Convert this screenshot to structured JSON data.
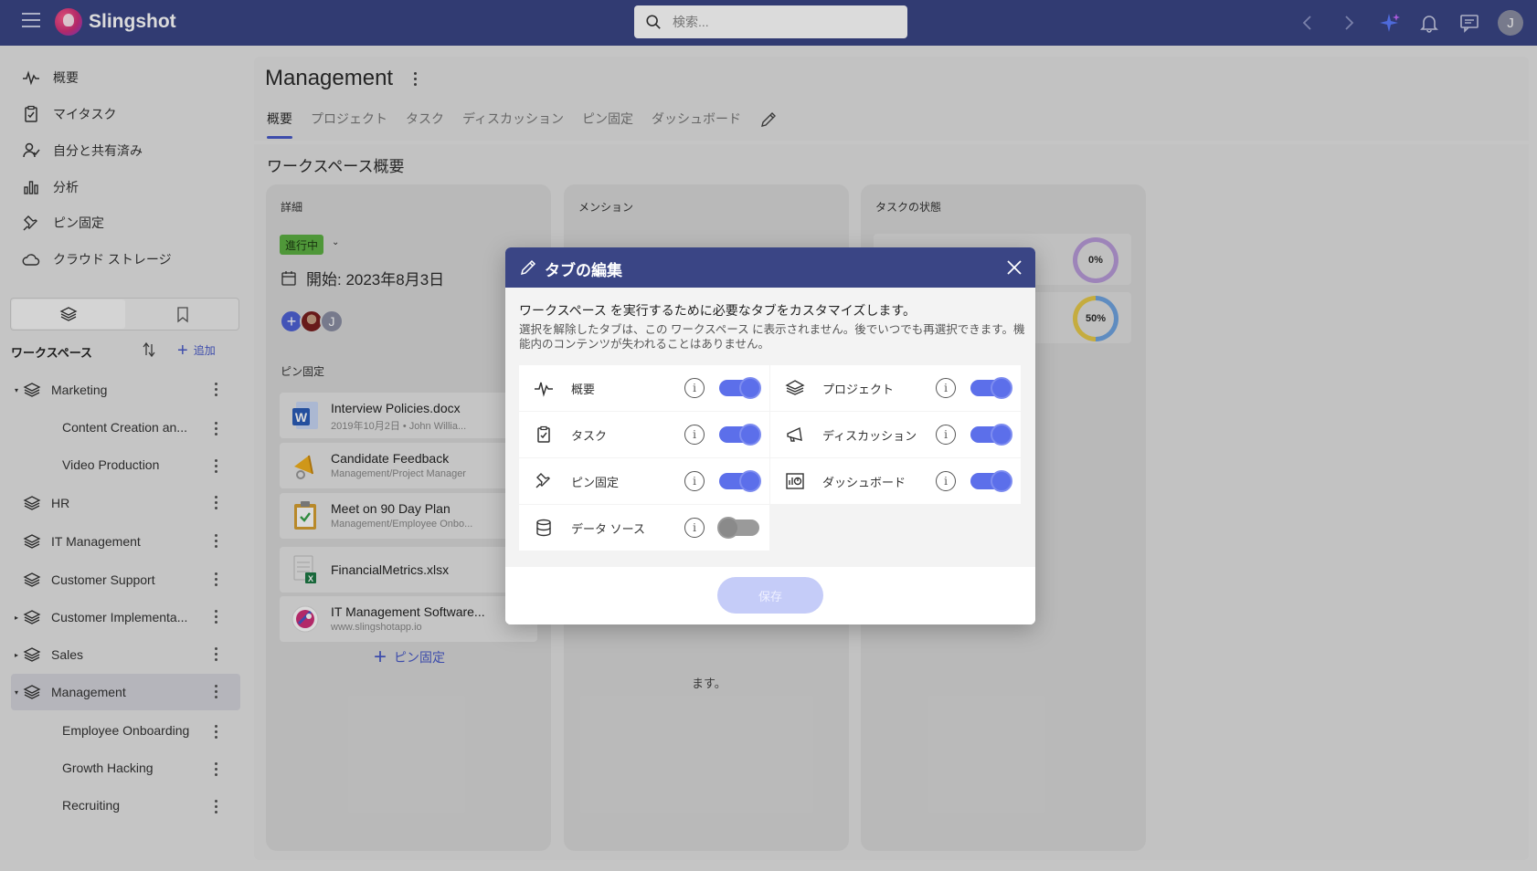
{
  "app": {
    "brand": "Slingshot",
    "user_initial": "J"
  },
  "search": {
    "placeholder": "検索..."
  },
  "nav": [
    {
      "label": "概要",
      "icon": "activity-icon"
    },
    {
      "label": "マイタスク",
      "icon": "clipboard-check-icon"
    },
    {
      "label": "自分と共有済み",
      "icon": "user-check-icon"
    },
    {
      "label": "分析",
      "icon": "bar-chart-icon"
    },
    {
      "label": "ピン固定",
      "icon": "pin-icon"
    },
    {
      "label": "クラウド ストレージ",
      "icon": "cloud-icon"
    }
  ],
  "workspaces": {
    "title": "ワークスペース",
    "add_label": "追加",
    "items": [
      {
        "label": "Marketing",
        "expanded": true
      },
      {
        "label": "Content Creation an...",
        "sub": true
      },
      {
        "label": "Video Production",
        "sub": true
      },
      {
        "label": "HR"
      },
      {
        "label": "IT Management"
      },
      {
        "label": "Customer Support"
      },
      {
        "label": "Customer Implementa...",
        "collapsed": true
      },
      {
        "label": "Sales",
        "collapsed": true
      },
      {
        "label": "Management",
        "expanded": true,
        "active": true
      },
      {
        "label": "Employee Onboarding",
        "sub": true
      },
      {
        "label": "Growth Hacking",
        "sub": true
      },
      {
        "label": "Recruiting",
        "sub": true
      }
    ]
  },
  "page": {
    "title": "Management",
    "tabs": [
      "概要",
      "プロジェクト",
      "タスク",
      "ディスカッション",
      "ピン固定",
      "ダッシュボード"
    ],
    "active_tab": "概要",
    "section_title": "ワークスペース概要"
  },
  "details": {
    "title": "詳細",
    "status": "進行中",
    "start": "開始: 2023年8月3日",
    "pinned_label": "ピン固定",
    "pinned": [
      {
        "name": "Interview Policies.docx",
        "sub": "2019年10月2日 • John Willia...",
        "icon": "word-doc-icon"
      },
      {
        "name": "Candidate Feedback",
        "sub": "Management/Project Manager",
        "icon": "megaphone-icon"
      },
      {
        "name": "Meet on 90 Day Plan",
        "sub": "Management/Employee Onbo...",
        "icon": "clipboard-task-icon"
      },
      {
        "name": "FinancialMetrics.xlsx",
        "sub": "",
        "icon": "excel-file-icon"
      },
      {
        "name": "IT Management Software...",
        "sub": "www.slingshotapp.io",
        "icon": "slingshot-link-icon"
      }
    ],
    "add_pin": "ピン固定"
  },
  "mentions": {
    "title": "メンション",
    "tail_text": "ます。"
  },
  "task_status": {
    "title": "タスクの状態",
    "rows": [
      {
        "percent": "0%",
        "value": 0
      },
      {
        "percent": "50%",
        "value": 50
      }
    ]
  },
  "dialog": {
    "title": "タブの編集",
    "lead": "ワークスペース を実行するために必要なタブをカスタマイズします。",
    "desc": "選択を解除したタブは、この ワークスペース に表示されません。後でいつでも再選択できます。機能内のコンテンツが失われることはありません。",
    "options": [
      {
        "label": "概要",
        "icon": "activity-icon",
        "on": true
      },
      {
        "label": "プロジェクト",
        "icon": "layers-icon",
        "on": true
      },
      {
        "label": "タスク",
        "icon": "clipboard-check-icon",
        "on": true
      },
      {
        "label": "ディスカッション",
        "icon": "megaphone-icon",
        "on": true
      },
      {
        "label": "ピン固定",
        "icon": "pin-icon",
        "on": true
      },
      {
        "label": "ダッシュボード",
        "icon": "dashboard-icon",
        "on": true
      },
      {
        "label": "データ ソース",
        "icon": "database-icon",
        "on": false
      }
    ],
    "save_label": "保存"
  },
  "colors": {
    "header": "#3a4585",
    "accent": "#5c6fea",
    "status_green": "#5db043"
  }
}
